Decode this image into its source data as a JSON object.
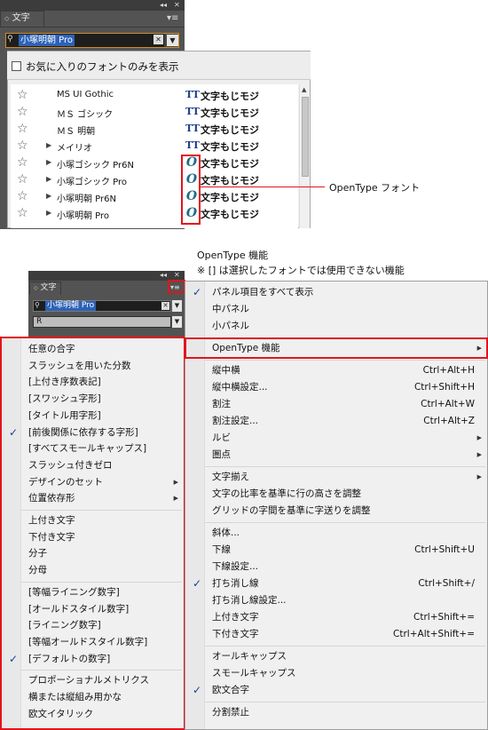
{
  "panel1": {
    "title": "文字",
    "font_field_value": "小塚明朝 Pro",
    "favorites_label": "お気に入りのフォントのみを表示",
    "fonts": [
      {
        "name": "MS UI Gothic",
        "type": "TT",
        "sample": "文字もじモジ",
        "has_children": false
      },
      {
        "name": "ＭＳ ゴシック",
        "type": "TT",
        "sample": "文字もじモジ",
        "has_children": false
      },
      {
        "name": "ＭＳ 明朝",
        "type": "TT",
        "sample": "文字もじモジ",
        "has_children": false
      },
      {
        "name": "メイリオ",
        "type": "TT",
        "sample": "文字もじモジ",
        "has_children": true
      },
      {
        "name": "小塚ゴシック Pr6N",
        "type": "O",
        "sample": "文字もじモジ",
        "has_children": true
      },
      {
        "name": "小塚ゴシック Pro",
        "type": "O",
        "sample": "文字もじモジ",
        "has_children": true
      },
      {
        "name": "小塚明朝 Pr6N",
        "type": "O",
        "sample": "文字もじモジ",
        "has_children": true
      },
      {
        "name": "小塚明朝 Pro",
        "type": "O",
        "sample": "文字もじモジ",
        "has_children": true
      }
    ],
    "annotation": "OpenType フォント"
  },
  "annotation2": {
    "line1": "OpenType 機能",
    "line2": "※ [] は選択したフォントでは使用できない機能"
  },
  "panel2": {
    "title": "文字",
    "font_field_value": "小塚明朝 Pro",
    "style_field_value": "R"
  },
  "left_menu": {
    "groups": [
      [
        {
          "label": "任意の合字",
          "checked": false,
          "submenu": false
        },
        {
          "label": "スラッシュを用いた分数",
          "checked": false,
          "submenu": false
        },
        {
          "label": "[上付き序数表記]",
          "checked": false,
          "submenu": false
        },
        {
          "label": "[スワッシュ字形]",
          "checked": false,
          "submenu": false
        },
        {
          "label": "[タイトル用字形]",
          "checked": false,
          "submenu": false
        },
        {
          "label": "[前後関係に依存する字形]",
          "checked": true,
          "submenu": false
        },
        {
          "label": "[すべてスモールキャップス]",
          "checked": false,
          "submenu": false
        },
        {
          "label": "スラッシュ付きゼロ",
          "checked": false,
          "submenu": false
        },
        {
          "label": "デザインのセット",
          "checked": false,
          "submenu": true
        },
        {
          "label": "位置依存形",
          "checked": false,
          "submenu": true
        }
      ],
      [
        {
          "label": "上付き文字",
          "checked": false,
          "submenu": false
        },
        {
          "label": "下付き文字",
          "checked": false,
          "submenu": false
        },
        {
          "label": "分子",
          "checked": false,
          "submenu": false
        },
        {
          "label": "分母",
          "checked": false,
          "submenu": false
        }
      ],
      [
        {
          "label": "[等幅ライニング数字]",
          "checked": false,
          "submenu": false
        },
        {
          "label": "[オールドスタイル数字]",
          "checked": false,
          "submenu": false
        },
        {
          "label": "[ライニング数字]",
          "checked": false,
          "submenu": false
        },
        {
          "label": "[等幅オールドスタイル数字]",
          "checked": false,
          "submenu": false
        },
        {
          "label": "[デフォルトの数字]",
          "checked": true,
          "submenu": false
        }
      ],
      [
        {
          "label": "プロポーショナルメトリクス",
          "checked": false,
          "submenu": false
        },
        {
          "label": "横または縦組み用かな",
          "checked": false,
          "submenu": false
        },
        {
          "label": "欧文イタリック",
          "checked": false,
          "submenu": false
        }
      ]
    ]
  },
  "right_menu": {
    "groups": [
      [
        {
          "label": "パネル項目をすべて表示",
          "checked": true,
          "shortcut": "",
          "submenu": false
        },
        {
          "label": "中パネル",
          "checked": false,
          "shortcut": "",
          "submenu": false
        },
        {
          "label": "小パネル",
          "checked": false,
          "shortcut": "",
          "submenu": false
        }
      ],
      [
        {
          "label": "OpenType 機能",
          "checked": false,
          "shortcut": "",
          "submenu": true
        }
      ],
      [
        {
          "label": "縦中横",
          "checked": false,
          "shortcut": "Ctrl+Alt+H",
          "submenu": false
        },
        {
          "label": "縦中横設定...",
          "checked": false,
          "shortcut": "Ctrl+Shift+H",
          "submenu": false
        },
        {
          "label": "割注",
          "checked": false,
          "shortcut": "Ctrl+Alt+W",
          "submenu": false
        },
        {
          "label": "割注設定...",
          "checked": false,
          "shortcut": "Ctrl+Alt+Z",
          "submenu": false
        },
        {
          "label": "ルビ",
          "checked": false,
          "shortcut": "",
          "submenu": true
        },
        {
          "label": "圏点",
          "checked": false,
          "shortcut": "",
          "submenu": true
        }
      ],
      [
        {
          "label": "文字揃え",
          "checked": false,
          "shortcut": "",
          "submenu": true
        },
        {
          "label": "文字の比率を基準に行の高さを調整",
          "checked": false,
          "shortcut": "",
          "submenu": false
        },
        {
          "label": "グリッドの字間を基準に字送りを調整",
          "checked": false,
          "shortcut": "",
          "submenu": false
        }
      ],
      [
        {
          "label": "斜体...",
          "checked": false,
          "shortcut": "",
          "submenu": false
        },
        {
          "label": "下線",
          "checked": false,
          "shortcut": "Ctrl+Shift+U",
          "submenu": false
        },
        {
          "label": "下線設定...",
          "checked": false,
          "shortcut": "",
          "submenu": false
        },
        {
          "label": "打ち消し線",
          "checked": true,
          "shortcut": "Ctrl+Shift+/",
          "submenu": false
        },
        {
          "label": "打ち消し線設定...",
          "checked": false,
          "shortcut": "",
          "submenu": false
        },
        {
          "label": "上付き文字",
          "checked": false,
          "shortcut": "Ctrl+Shift+=",
          "submenu": false
        },
        {
          "label": "下付き文字",
          "checked": false,
          "shortcut": "Ctrl+Alt+Shift+=",
          "submenu": false
        }
      ],
      [
        {
          "label": "オールキャップス",
          "checked": false,
          "shortcut": "",
          "submenu": false
        },
        {
          "label": "スモールキャップス",
          "checked": false,
          "shortcut": "",
          "submenu": false
        },
        {
          "label": "欧文合字",
          "checked": true,
          "shortcut": "",
          "submenu": false
        }
      ],
      [
        {
          "label": "分割禁止",
          "checked": false,
          "shortcut": "",
          "submenu": false
        }
      ]
    ]
  },
  "colors": {
    "highlight_red": "#e3141b",
    "selection_blue": "#2c62b8",
    "check_blue": "#1a3e9a",
    "panel_dark": "#535353"
  }
}
